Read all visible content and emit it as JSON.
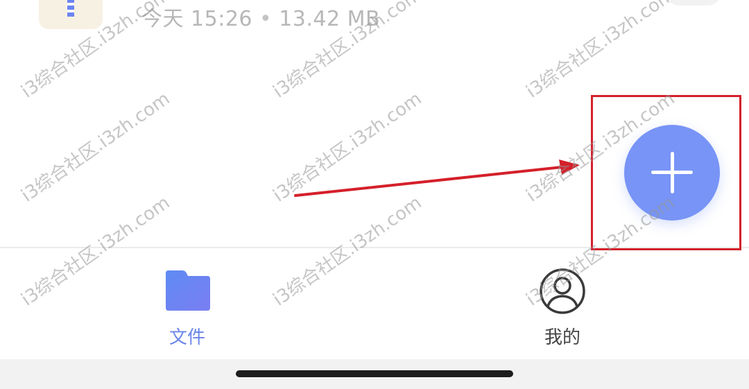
{
  "file_row": {
    "date_label": "今天 15:26",
    "separator": "•",
    "size_label": "13.42 MB"
  },
  "fab": {
    "icon": "plus-icon",
    "color": "#7794f6"
  },
  "tabbar": {
    "tabs": [
      {
        "label": "文件",
        "icon": "folder-icon",
        "active": true,
        "color": "#6a85e8"
      },
      {
        "label": "我的",
        "icon": "profile-icon",
        "active": false,
        "color": "#444444"
      }
    ]
  },
  "watermark": {
    "text": "i3综合社区.i3zh.com"
  },
  "annotation": {
    "color": "#d4202a"
  }
}
